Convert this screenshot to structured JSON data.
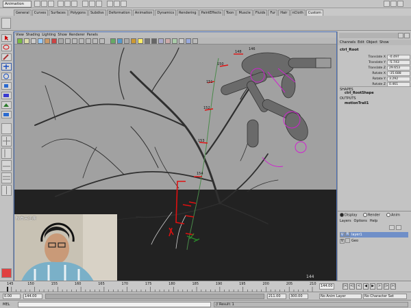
{
  "app": {
    "mode": "Animation"
  },
  "shelf_tabs": [
    "General",
    "Curves",
    "Surfaces",
    "Polygons",
    "Subdivs",
    "Deformation",
    "Animation",
    "Dynamics",
    "Rendering",
    "PaintEffects",
    "Toon",
    "Muscle",
    "Fluids",
    "Fur",
    "Hair",
    "nCloth",
    "Custom"
  ],
  "shelf_active_tab": "Custom",
  "viewport": {
    "menu": [
      "View",
      "Shading",
      "Lighting",
      "Show",
      "Renderer",
      "Panels"
    ],
    "frame_label": "144",
    "curve_labels": [
      "146",
      "148",
      "150",
      "151",
      "152",
      "153",
      "154"
    ],
    "webcam_caption": "秋香未注册"
  },
  "channel_box": {
    "menu": [
      "Channels",
      "Edit",
      "Object",
      "Show"
    ],
    "object_name": "ctrl_Root",
    "attributes": [
      {
        "name": "Translate X",
        "value": "-0.497"
      },
      {
        "name": "Translate Y",
        "value": "-5.743"
      },
      {
        "name": "Translate Z",
        "value": "29.653"
      },
      {
        "name": "Rotate X",
        "value": "-35.688"
      },
      {
        "name": "Rotate Y",
        "value": "3.292"
      },
      {
        "name": "Rotate Z",
        "value": "0.461"
      }
    ],
    "shapes_label": "SHAPES",
    "shape_name": "ctrl_RootShape",
    "outputs_label": "OUTPUTS",
    "output_name": "motionTrail1"
  },
  "layer_editor": {
    "modes": [
      "Display",
      "Render",
      "Anim"
    ],
    "active_mode": "Display",
    "menu": [
      "Layers",
      "Options",
      "Help"
    ],
    "layers": [
      {
        "v": "V",
        "r": "R",
        "name": "layer1",
        "selected": true
      },
      {
        "v": "V",
        "r": "",
        "name": "Geo",
        "selected": false
      }
    ]
  },
  "time_slider": {
    "ticks": [
      "145",
      "150",
      "155",
      "160",
      "165",
      "170",
      "175",
      "180",
      "185",
      "190",
      "195",
      "200",
      "205",
      "210"
    ],
    "current_frame": "144.00"
  },
  "range_slider": {
    "start": "0.00",
    "playback_start": "144.00",
    "playback_end": "211.00",
    "end": "300.00",
    "anim_layer": "No Anim Layer",
    "character_set": "No Character Set"
  },
  "command_line": {
    "label": "MEL",
    "result": "// Result: 1"
  },
  "colors": {
    "viewport_bg": "#a1a1a1",
    "motion_trail": "#4a8a4a",
    "annotation_red": "#e01010",
    "selected_layer": "#6f8fc8"
  }
}
